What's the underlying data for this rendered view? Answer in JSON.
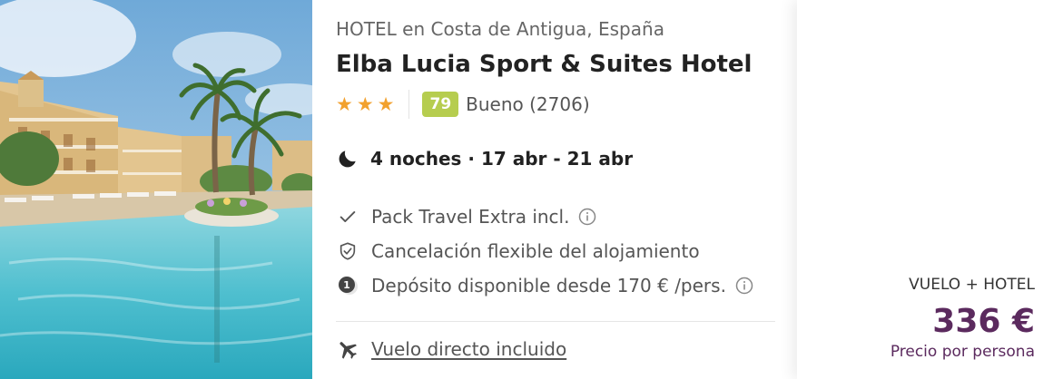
{
  "photo": {
    "alt_icon": "hotel-photo"
  },
  "hotel": {
    "category": "HOTEL en Costa de Antigua, España",
    "name": "Elba Lucia Sport & Suites Hotel",
    "stars": 3,
    "star_glyph": "★",
    "score": "79",
    "score_text": "Bueno (2706)",
    "score_color": "#b6cd4f"
  },
  "stay": {
    "text": "4 noches · 17 abr - 21 abr"
  },
  "features": [
    {
      "icon": "check-icon",
      "label": "Pack Travel Extra incl.",
      "has_info": true
    },
    {
      "icon": "shield-check-icon",
      "label": "Cancelación flexible del alojamiento",
      "has_info": false
    },
    {
      "icon": "deposit-coin-icon",
      "label": "Depósito disponible desde 170 € /pers.",
      "has_info": true
    }
  ],
  "flight": {
    "icon": "plane-icon",
    "label": "Vuelo directo incluido"
  },
  "price": {
    "label": "VUELO + HOTEL",
    "amount": "336 €",
    "sub": "Precio por persona",
    "color": "#5b2a5e"
  }
}
